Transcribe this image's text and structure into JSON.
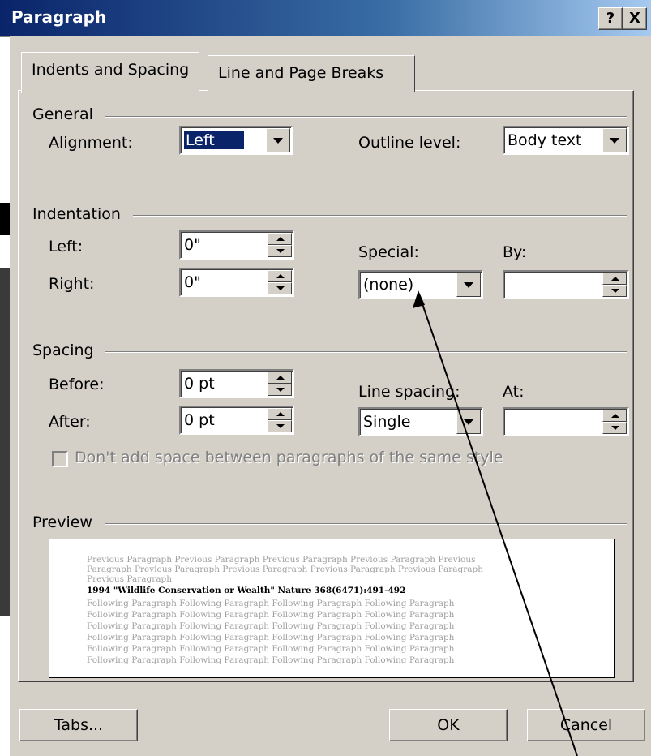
{
  "window": {
    "title": "Paragraph",
    "help_label": "?",
    "close_label": "X"
  },
  "tabs": [
    {
      "label": "Indents and Spacing",
      "active": true
    },
    {
      "label": "Line and Page Breaks",
      "active": false
    }
  ],
  "general": {
    "group_label": "General",
    "alignment_label": "Alignment:",
    "alignment_value": "Left",
    "outline_label": "Outline level:",
    "outline_value": "Body text"
  },
  "indentation": {
    "group_label": "Indentation",
    "left_label": "Left:",
    "left_value": "0\"",
    "right_label": "Right:",
    "right_value": "0\"",
    "special_label": "Special:",
    "special_value": "(none)",
    "by_label": "By:",
    "by_value": ""
  },
  "spacing": {
    "group_label": "Spacing",
    "before_label": "Before:",
    "before_value": "0 pt",
    "after_label": "After:",
    "after_value": "0 pt",
    "line_spacing_label": "Line spacing:",
    "line_spacing_value": "Single",
    "at_label": "At:",
    "at_value": "",
    "dont_add_label": "Don't add space between paragraphs of the same style",
    "dont_add_checked": false
  },
  "preview": {
    "group_label": "Preview",
    "previous_lines": [
      "Previous Paragraph Previous Paragraph Previous Paragraph Previous Paragraph Previous",
      "Paragraph Previous Paragraph Previous Paragraph Previous Paragraph Previous Paragraph",
      "Previous Paragraph"
    ],
    "current_line": "1994 \"Wildlife Conservation or Wealth\" Nature 368(6471):491-492",
    "following_lines": [
      "Following Paragraph Following Paragraph Following Paragraph Following Paragraph",
      "Following Paragraph Following Paragraph Following Paragraph Following Paragraph",
      "Following Paragraph Following Paragraph Following Paragraph Following Paragraph",
      "Following Paragraph Following Paragraph Following Paragraph Following Paragraph",
      "Following Paragraph Following Paragraph Following Paragraph Following Paragraph",
      "Following Paragraph Following Paragraph Following Paragraph Following Paragraph"
    ]
  },
  "buttons": {
    "tabs": "Tabs...",
    "ok": "OK",
    "cancel": "Cancel"
  },
  "icons": [
    "spin-up-icon",
    "spin-down-icon",
    "dropdown-arrow-icon",
    "annotation-arrow-icon"
  ]
}
